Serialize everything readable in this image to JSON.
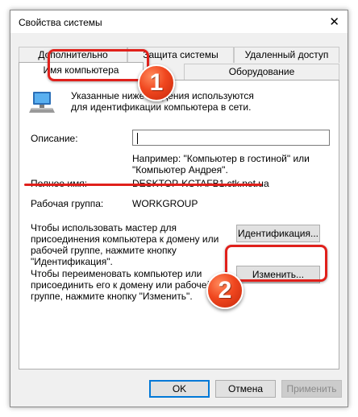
{
  "window": {
    "title": "Свойства системы",
    "close_glyph": "✕"
  },
  "tabs": {
    "row1": [
      "Дополнительно",
      "Защита системы",
      "Удаленный доступ"
    ],
    "row2": [
      "Имя компьютера",
      "Оборудование"
    ],
    "active": "Имя компьютера"
  },
  "panel": {
    "intro": "Указанные ниже сведения используются для идентификации компьютера в сети.",
    "description_label": "Описание:",
    "description_value": "",
    "example": "Например: \"Компьютер в гостиной\" или \"Компьютер Андрея\".",
    "full_name_label": "Полное имя:",
    "full_name_value": "DESKTOP-KCTAFB1.ctk.net.ua",
    "workgroup_label": "Рабочая группа:",
    "workgroup_value": "WORKGROUP",
    "identify_text": "Чтобы использовать мастер для присоединения компьютера к домену или рабочей группе, нажмите кнопку \"Идентификация\".",
    "identify_button": "Идентификация...",
    "rename_text": "Чтобы переименовать компьютер или присоединить его к домену или рабочей группе, нажмите кнопку \"Изменить\".",
    "change_button": "Изменить..."
  },
  "footer": {
    "ok": "OK",
    "cancel": "Отмена",
    "apply": "Применить"
  },
  "annotations": {
    "step1": "1",
    "step2": "2",
    "color": "#e0201b"
  },
  "colors": {
    "focus_border": "#0078d7",
    "window_bg": "#f0f0f0"
  }
}
